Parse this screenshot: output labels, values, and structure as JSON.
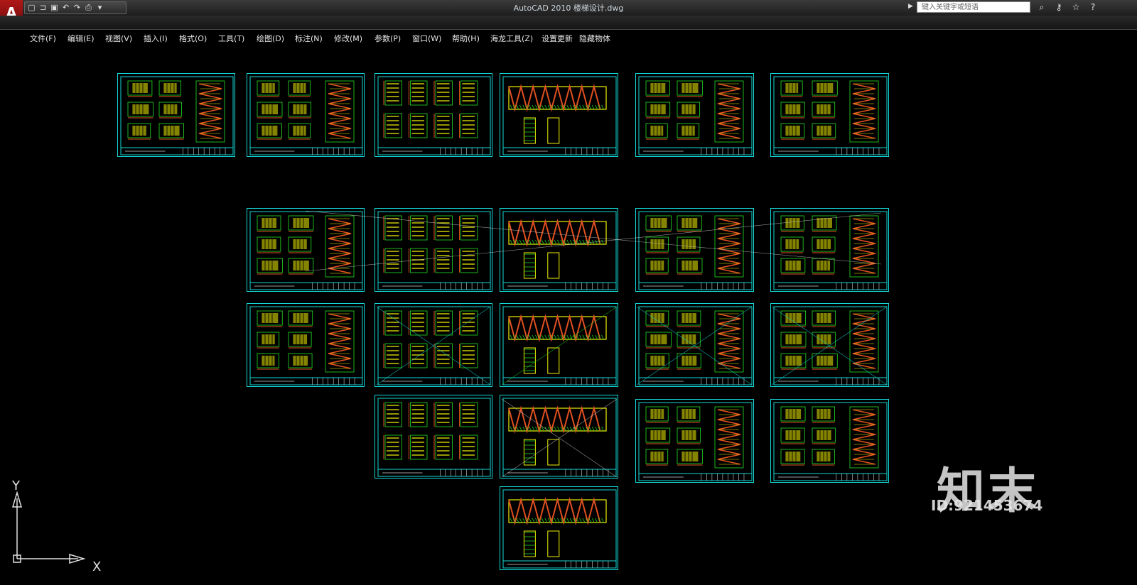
{
  "app": {
    "window_title": "AutoCAD 2010    楼梯设计.dwg",
    "logo_letter": "A"
  },
  "search": {
    "placeholder": "键入关键字或短语"
  },
  "menu": [
    {
      "label": "文件(F)"
    },
    {
      "label": "编辑(E)"
    },
    {
      "label": "视图(V)"
    },
    {
      "label": "插入(I)"
    },
    {
      "label": "格式(O)"
    },
    {
      "label": "工具(T)"
    },
    {
      "label": "绘图(D)"
    },
    {
      "label": "标注(N)"
    },
    {
      "label": "修改(M)"
    },
    {
      "label": "参数(P)"
    },
    {
      "label": "窗口(W)"
    },
    {
      "label": "帮助(H)"
    },
    {
      "label": "海龙工具(Z)"
    },
    {
      "label": "设置更新"
    },
    {
      "label": "隐藏物体"
    }
  ],
  "qat_icons": [
    "new-icon",
    "open-icon",
    "save-icon",
    "undo-icon",
    "redo-icon",
    "plot-icon",
    "dropdown-icon"
  ],
  "title_tools": [
    "binoculars-icon",
    "key-icon",
    "star-icon",
    "help-icon"
  ],
  "ucs": {
    "y_label": "Y",
    "x_label": "X"
  },
  "watermark": {
    "text": "知末",
    "id": "ID:921453674"
  },
  "colors": {
    "sheet_border": "#14d6d6",
    "line_yellow": "#f0f000",
    "line_green": "#22e022",
    "line_orange": "#e05020",
    "background": "#000000"
  },
  "sheets": [
    {
      "kind": "plans"
    },
    {
      "kind": "plans"
    },
    {
      "kind": "sections"
    },
    {
      "kind": "elevation"
    },
    {
      "kind": "plans"
    },
    {
      "kind": "plans"
    },
    {
      "kind": "plans"
    },
    {
      "kind": "sections"
    },
    {
      "kind": "elevation"
    },
    {
      "kind": "plans"
    },
    {
      "kind": "plans"
    },
    {
      "kind": "plans"
    },
    {
      "kind": "sections"
    },
    {
      "kind": "elevation"
    },
    {
      "kind": "plans"
    },
    {
      "kind": "plans"
    },
    {
      "kind": "sections"
    },
    {
      "kind": "elevation"
    },
    {
      "kind": "plans"
    },
    {
      "kind": "plans"
    },
    {
      "kind": "elevation"
    }
  ]
}
